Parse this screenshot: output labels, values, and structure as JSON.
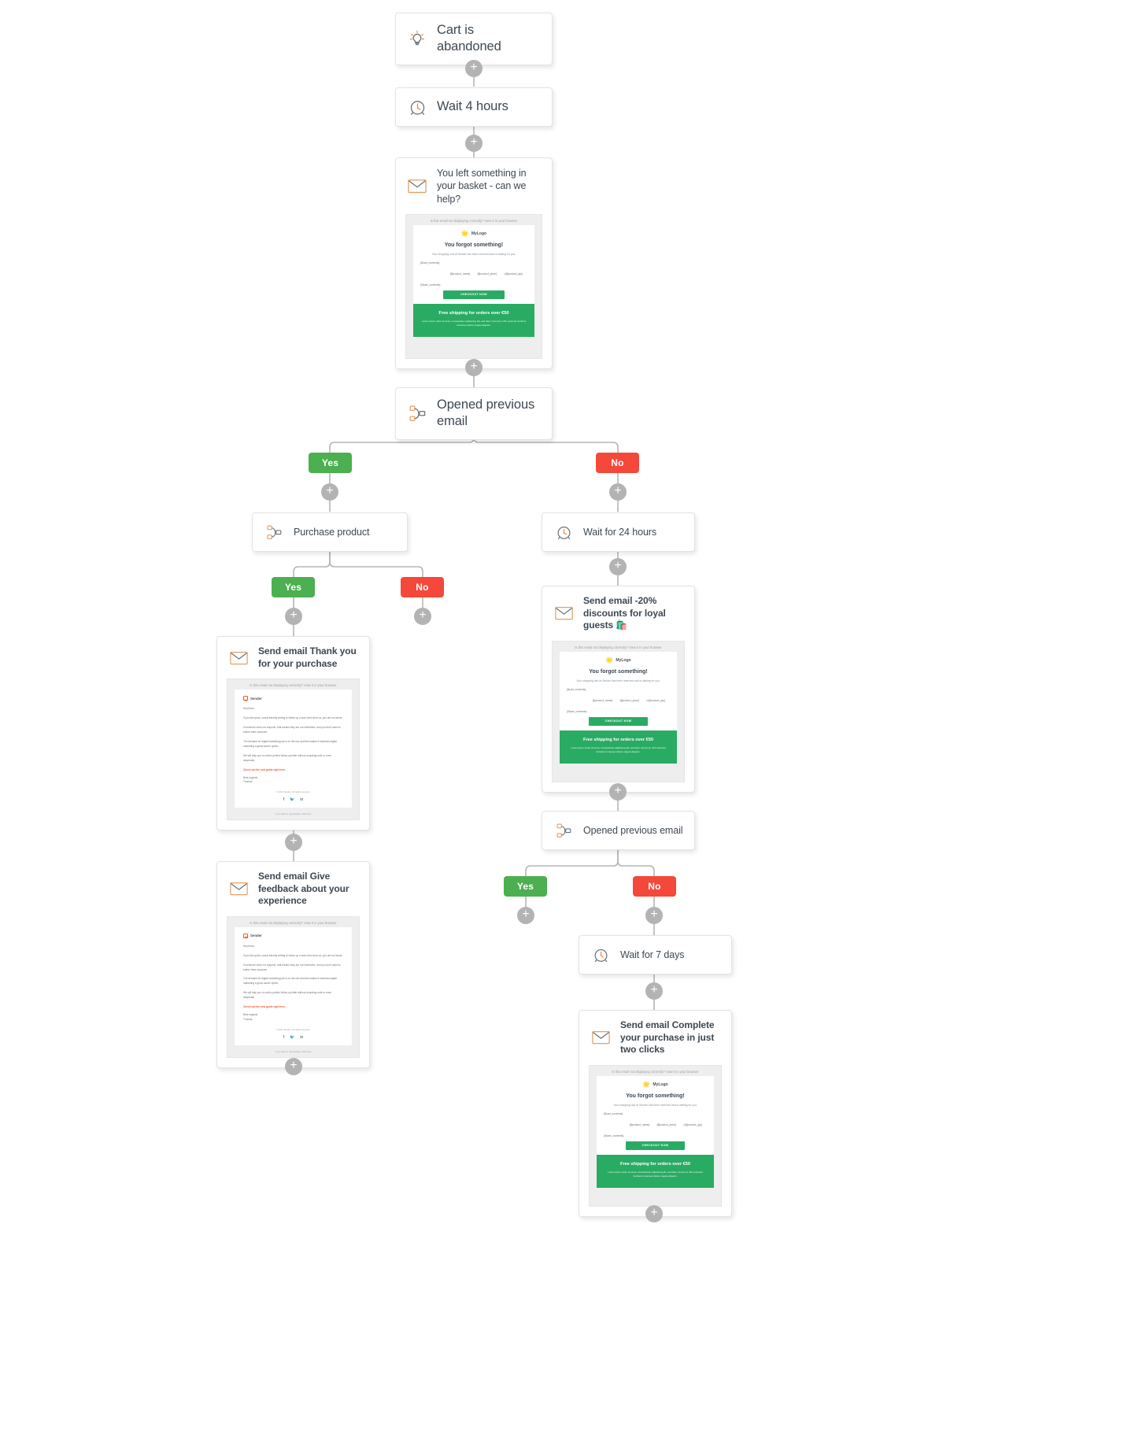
{
  "workflow": {
    "nodes": [
      {
        "id": "trigger",
        "icon": "lightbulb-icon",
        "title": "Cart is abandoned"
      },
      {
        "id": "wait4h",
        "icon": "clock-icon",
        "title": "Wait 4 hours"
      },
      {
        "id": "email1",
        "icon": "envelope-icon",
        "title": "You left something in your basket - can we help?"
      },
      {
        "id": "cond1",
        "icon": "branch-icon",
        "title": "Opened previous email"
      },
      {
        "id": "purchase",
        "icon": "branch-icon",
        "title": "Purchase product"
      },
      {
        "id": "wait24h",
        "icon": "clock-icon",
        "title": "Wait for 24 hours"
      },
      {
        "id": "email2",
        "icon": "envelope-icon",
        "title": "Send email -20% discounts for loyal guests 🛍️"
      },
      {
        "id": "emailThanks",
        "icon": "envelope-icon",
        "title": "Send email Thank you for your purchase"
      },
      {
        "id": "emailFeed",
        "icon": "envelope-icon",
        "title": "Send email Give feedback about your experience"
      },
      {
        "id": "cond2",
        "icon": "branch-icon",
        "title": "Opened previous email"
      },
      {
        "id": "wait7d",
        "icon": "clock-icon",
        "title": "Wait for 7 days"
      },
      {
        "id": "email3",
        "icon": "envelope-icon",
        "title": "Send email Complete your purchase in just two clicks"
      }
    ],
    "branch_labels": {
      "yes": "Yes",
      "no": "No"
    },
    "add_step_label": "+",
    "colors": {
      "yes": "#4caf50",
      "no": "#f4483b",
      "accent": "#2aab63",
      "line": "#b5b5b5",
      "handle": "#b3b3b3"
    }
  },
  "cart_email_preview": {
    "top_note": "Is this email not displaying correctly? View it in your browser",
    "brand": "MyLogo",
    "heading": "You forgot something!",
    "subheading": "Your shopping cart at Sender has been reserved and is waiting for you.",
    "tag_open": "{$cart_contents}",
    "product_fields": [
      "{$product_name}",
      "{$product_price}",
      "×{$product_qty}"
    ],
    "tag_close": "{/$cart_contents}",
    "cta": "CHECKOUT NOW",
    "banner_heading": "Free shipping for orders over €50",
    "banner_text": "Lorem ipsum dolor sit amet, consectetuer adipiscing elit, sed diam nonummy nibh euismod tincidunt ut laoreet dolore magna aliquam."
  },
  "transactional_email_preview": {
    "top_note": "Is this email not displaying correctly? View it in your browser",
    "brand": "Sender",
    "greeting": "Hey there,",
    "paragraphs": [
      "If you like quick, social-friendly writing to follow up a lead, then trust us, you are not alone.",
      "If someone does not respond, that means they are not interested, and you don't want to bother them anymore.",
      "The demand for digital marketing just is on the rise and this makes it business digital marketing a great career option.",
      "We will help you to craft a perfect follow-up letter without sounding rude or even desperate."
    ],
    "link": "Check out the new guide right here.",
    "signoff": "Best regards,",
    "signature": "Thomas",
    "copyright": "© 2021 Sender. All rights reserved.",
    "social": [
      "facebook-icon",
      "twitter-icon",
      "linkedin-icon"
    ],
    "unsubscribe": "If you wish to unsubscribe, click here"
  }
}
